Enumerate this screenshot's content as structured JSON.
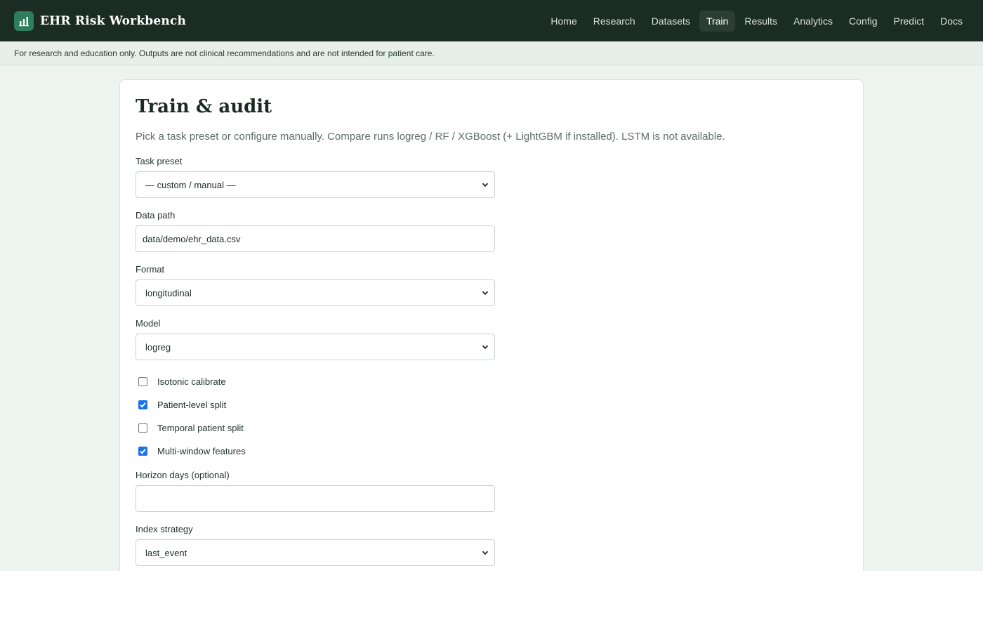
{
  "app": {
    "title": "EHR Risk Workbench",
    "logo_icon": "bar-chart-icon"
  },
  "nav": {
    "items": [
      "Home",
      "Research",
      "Datasets",
      "Train",
      "Results",
      "Analytics",
      "Config",
      "Predict",
      "Docs"
    ],
    "active": "Train"
  },
  "disclaimer": "For research and education only. Outputs are not clinical recommendations and are not intended for patient care.",
  "page": {
    "title": "Train & audit",
    "subtitle": "Pick a task preset or configure manually. Compare runs logreg / RF / XGBoost (+ LightGBM if installed). LSTM is not available."
  },
  "form": {
    "task_preset": {
      "label": "Task preset",
      "value": "— custom / manual —"
    },
    "data_path": {
      "label": "Data path",
      "value": "data/demo/ehr_data.csv"
    },
    "format": {
      "label": "Format",
      "value": "longitudinal"
    },
    "model": {
      "label": "Model",
      "value": "logreg"
    },
    "checks": [
      {
        "label": "Isotonic calibrate",
        "checked": false
      },
      {
        "label": "Patient-level split",
        "checked": true
      },
      {
        "label": "Temporal patient split",
        "checked": false
      },
      {
        "label": "Multi-window features",
        "checked": true
      }
    ],
    "horizon_days": {
      "label": "Horizon days (optional)",
      "value": ""
    },
    "index_strategy": {
      "label": "Index strategy",
      "value": "last_event"
    }
  },
  "colors": {
    "header_bg": "#1b2c25",
    "accent": "#2e7d5f",
    "page_bg": "#edf4f0",
    "checkbox_checked": "#1a73e8"
  }
}
